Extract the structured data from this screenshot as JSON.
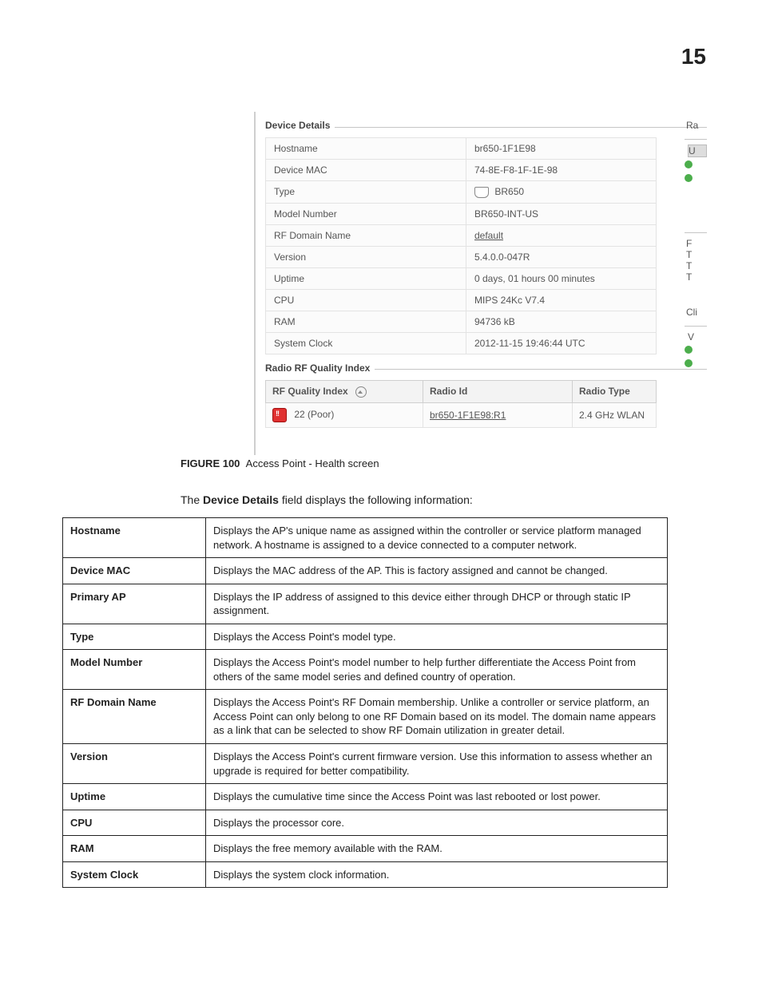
{
  "page_number": "15",
  "screenshot": {
    "device_details_legend": "Device Details",
    "rows": [
      {
        "label": "Hostname",
        "value": "br650-1F1E98"
      },
      {
        "label": "Device MAC",
        "value": "74-8E-F8-1F-1E-98"
      },
      {
        "label": "Type",
        "value": "BR650",
        "icon": true
      },
      {
        "label": "Model Number",
        "value": "BR650-INT-US"
      },
      {
        "label": "RF Domain Name",
        "value": "default",
        "link": true
      },
      {
        "label": "Version",
        "value": "5.4.0.0-047R"
      },
      {
        "label": "Uptime",
        "value": "0 days, 01 hours 00 minutes"
      },
      {
        "label": "CPU",
        "value": "MIPS 24Kc V7.4"
      },
      {
        "label": "RAM",
        "value": "94736 kB"
      },
      {
        "label": "System Clock",
        "value": "2012-11-15 19:46:44 UTC"
      }
    ],
    "rfq_legend": "Radio RF Quality Index",
    "rfq_headers": {
      "quality": "RF Quality Index",
      "radio_id": "Radio Id",
      "radio_type": "Radio Type"
    },
    "rfq_row": {
      "quality": "22 (Poor)",
      "radio_id": "br650-1F1E98:R1",
      "radio_type": "2.4 GHz WLAN"
    },
    "sidefrag": {
      "ra": "Ra",
      "u": "U",
      "f": "F",
      "t": "T",
      "cli": "Cli",
      "v": "V"
    }
  },
  "figure": {
    "label": "FIGURE 100",
    "caption": "Access Point - Health screen"
  },
  "intro_prefix": "The ",
  "intro_bold": "Device Details",
  "intro_suffix": " field displays the following information:",
  "desc": [
    {
      "term": "Hostname",
      "text": "Displays the AP's unique name as assigned within the controller or service platform managed network. A hostname is assigned to a device connected to a computer network."
    },
    {
      "term": "Device MAC",
      "text": "Displays the MAC address of the AP. This is factory assigned and cannot be changed."
    },
    {
      "term": "Primary AP",
      "text": "Displays the IP address of assigned to this device either through DHCP or through static IP assignment."
    },
    {
      "term": "Type",
      "text": "Displays the Access Point's model type."
    },
    {
      "term": "Model Number",
      "text": "Displays the Access Point's model number to help further differentiate the Access Point from others of the same model series and defined country of operation."
    },
    {
      "term": "RF Domain Name",
      "text": "Displays the Access Point's RF Domain membership. Unlike a controller or service platform, an Access Point can only belong to one RF Domain based on its model. The domain name appears as a link that can be selected to show RF Domain utilization in greater detail."
    },
    {
      "term": "Version",
      "text": "Displays the Access Point's current firmware version. Use this information to assess whether an upgrade is required for better compatibility."
    },
    {
      "term": "Uptime",
      "text": "Displays the cumulative time since the Access Point was last rebooted or lost power."
    },
    {
      "term": "CPU",
      "text": "Displays the processor core."
    },
    {
      "term": "RAM",
      "text": "Displays the free memory available with the RAM."
    },
    {
      "term": "System Clock",
      "text": "Displays the system clock information."
    }
  ]
}
